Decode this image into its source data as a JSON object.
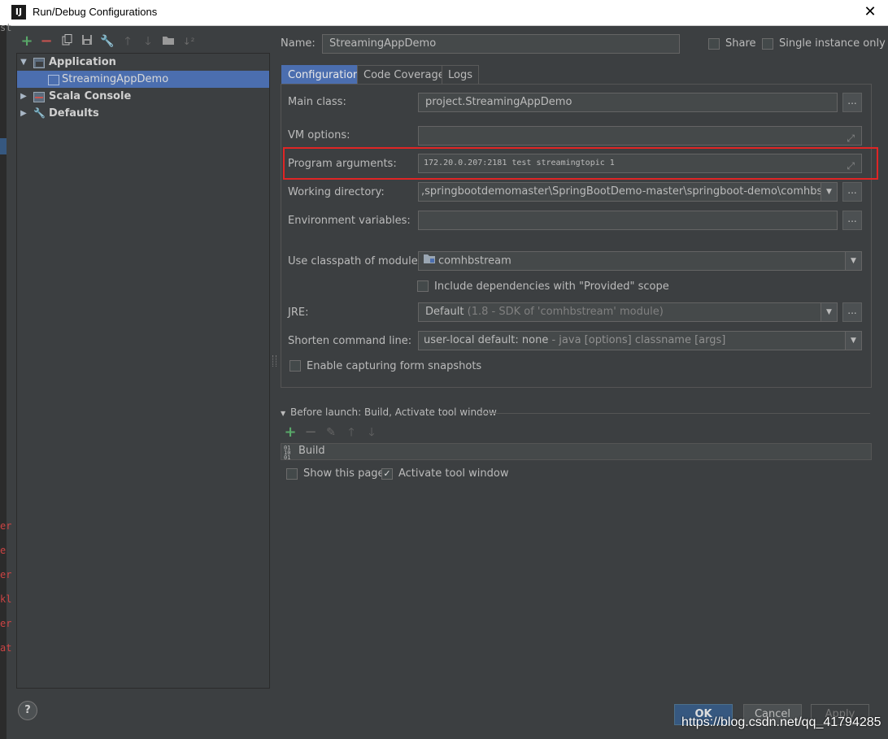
{
  "window": {
    "title": "Run/Debug Configurations",
    "app_icon_text": "IJ"
  },
  "toolbar": {
    "buttons": [
      "add-icon",
      "remove-icon",
      "copy-icon",
      "save-icon",
      "wrench-icon",
      "arrow-up-icon",
      "arrow-down-icon",
      "folder-icon",
      "sort-icon"
    ]
  },
  "tree": {
    "items": [
      {
        "label": "Application",
        "expanded": true
      },
      {
        "label": "StreamingAppDemo",
        "selected": true
      },
      {
        "label": "Scala Console",
        "expanded": false
      },
      {
        "label": "Defaults",
        "expanded": false
      }
    ]
  },
  "name": {
    "label": "Name:",
    "value": "StreamingAppDemo"
  },
  "share": {
    "label": "Share",
    "checked": false
  },
  "single_instance": {
    "label": "Single instance only",
    "checked": false
  },
  "tabs": [
    {
      "label": "Configuration",
      "active": true
    },
    {
      "label": "Code Coverage",
      "active": false
    },
    {
      "label": "Logs",
      "active": false
    }
  ],
  "form": {
    "main_class": {
      "label": "Main class:",
      "value": "project.StreamingAppDemo"
    },
    "vm_options": {
      "label": "VM options:",
      "value": ""
    },
    "program_arguments": {
      "label": "Program arguments:",
      "value": "172.20.0.207:2181 test streamingtopic 1"
    },
    "working_directory": {
      "label": "Working directory:",
      "value": ",springbootdemomaster\\SpringBootDemo-master\\springboot-demo\\comhbstream"
    },
    "env_vars": {
      "label": "Environment variables:",
      "value": ""
    },
    "classpath_module": {
      "label": "Use classpath of module:",
      "value": "comhbstream"
    },
    "include_provided": {
      "label": "Include dependencies with \"Provided\" scope",
      "checked": false
    },
    "jre": {
      "label": "JRE:",
      "value": "Default",
      "hint": "(1.8 - SDK of 'comhbstream' module)"
    },
    "shorten_cmd": {
      "label": "Shorten command line:",
      "value": "user-local default: none",
      "hint": "- java [options] classname [args]"
    },
    "capture_snapshots": {
      "label": "Enable capturing form snapshots",
      "checked": false
    }
  },
  "before_launch": {
    "header": "Before launch: Build, Activate tool window",
    "items": [
      "Build"
    ],
    "show_this_page": {
      "label": "Show this page",
      "checked": false
    },
    "activate_tool_window": {
      "label": "Activate tool window",
      "checked": true
    }
  },
  "buttons": {
    "ok": "OK",
    "cancel": "Cancel",
    "apply": "Apply",
    "help": "?"
  },
  "watermark": "https://blog.csdn.net/qq_41794285",
  "background_strip": [
    "st",
    "er",
    "e",
    "er",
    "kl",
    "er",
    "at"
  ],
  "colors": {
    "accent": "#4b6eaf",
    "selection": "#4b6eaf",
    "highlight_border": "#e02525",
    "add_green": "#59a869",
    "remove_red": "#c75450"
  }
}
